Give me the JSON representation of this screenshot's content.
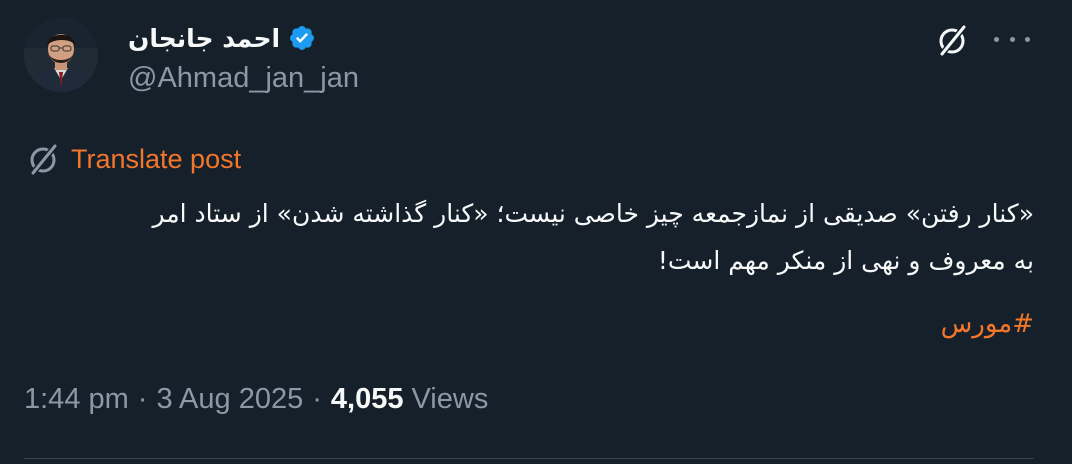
{
  "author": {
    "display_name": "احمد جانجان",
    "handle": "@Ahmad_jan_jan",
    "verified": true
  },
  "actions": {
    "grok_icon": "grok-icon",
    "more_icon": "more-horizontal-icon"
  },
  "translate": {
    "label": "Translate post"
  },
  "post": {
    "lines": [
      "«کنار رفتن» صدیقی از نمازجمعه چیز خاصی نیست؛ «کنار گذاشته شدن» از ستاد امر",
      "به معروف و نهی از منکر مهم است!"
    ],
    "hashtag": "#مورس"
  },
  "meta": {
    "time": "1:44 pm",
    "date": "3 Aug 2025",
    "views_count": "4,055",
    "views_label": "Views"
  },
  "colors": {
    "background": "#15202b",
    "text": "#f7f9f9",
    "secondary": "#8b98a5",
    "accent": "#f4762a",
    "verified": "#1d9bf0"
  }
}
